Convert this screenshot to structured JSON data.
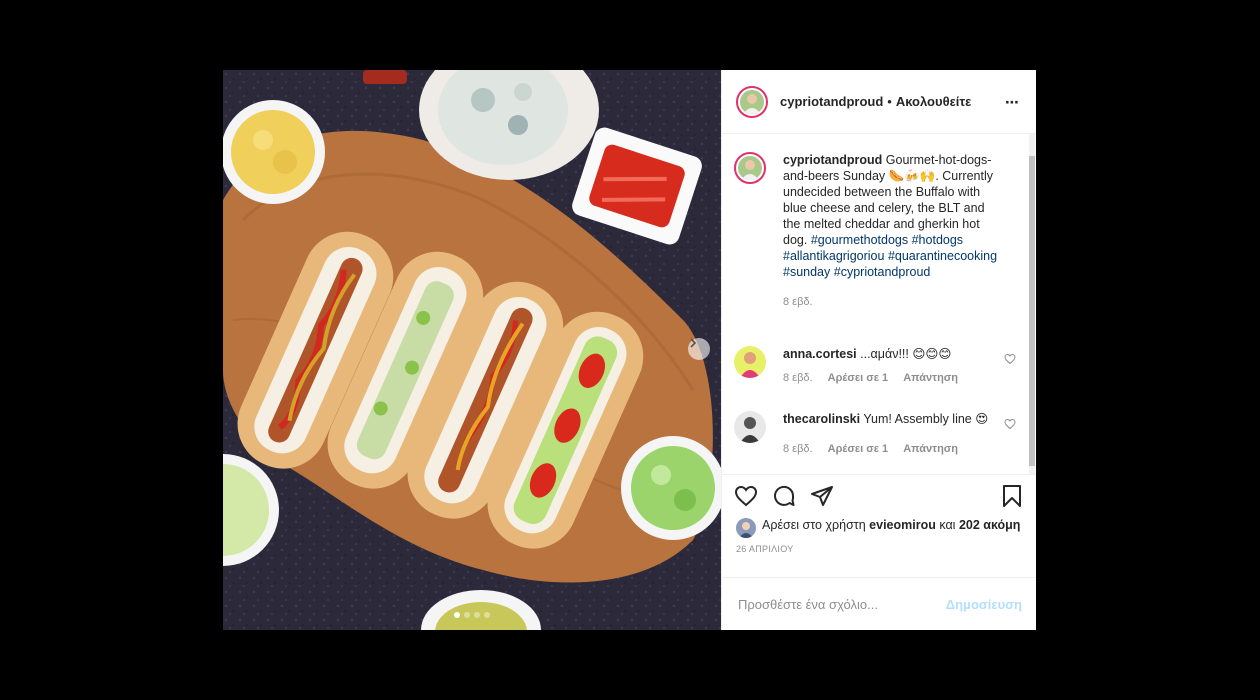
{
  "post": {
    "username": "cypriotandproud",
    "separator": "•",
    "follow_label": "Ακολουθείτε",
    "more_icon": "⋯"
  },
  "caption": {
    "username": "cypriotandproud",
    "text_before": "Gourmet-hot-dogs-and-beers Sunday 🌭🍻🙌. Currently undecided between the Buffalo with blue cheese and celery, the BLT and the melted cheddar and gherkin hot dog.",
    "hashtags": [
      "#gourmethotdogs",
      "#hotdogs",
      "#allantikagrigoriou",
      "#quarantinecooking",
      "#sunday",
      "#cypriotandproud"
    ],
    "time": "8 εβδ."
  },
  "comments": [
    {
      "username": "anna.cortesi",
      "text": "...αμάν!!! 😊😊😊",
      "time": "8 εβδ.",
      "likes": "Αρέσει σε 1",
      "reply": "Απάντηση"
    },
    {
      "username": "thecarolinski",
      "text": "Yum! Assembly line 😍",
      "time": "8 εβδ.",
      "likes": "Αρέσει σε 1",
      "reply": "Απάντηση"
    }
  ],
  "likes_line": {
    "prefix": "Αρέσει στο χρήστη",
    "user": "evieomirou",
    "middle": "και",
    "count": "202 ακόμη"
  },
  "date": "26 ΑΠΡΙΛΙΟΥ",
  "comment_box": {
    "placeholder": "Προσθέστε ένα σχόλιο...",
    "post_label": "Δημοσίευση"
  },
  "carousel": {
    "total": 4,
    "active": 1
  },
  "colors": {
    "link": "#00376b",
    "muted": "#8e8e8e",
    "post_disabled": "#b2dffc",
    "story_ring": "#e1306c"
  }
}
